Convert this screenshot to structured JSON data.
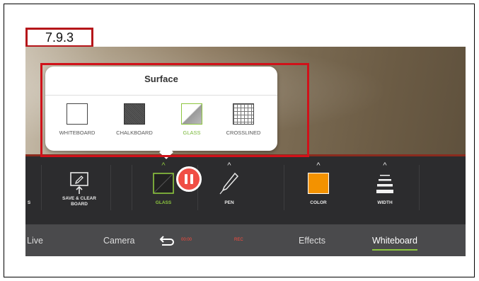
{
  "step_label": "7.9.3",
  "popup": {
    "title": "Surface",
    "options": [
      {
        "label": "WHITEBOARD",
        "icon": "whiteboard-swatch-icon",
        "selected": false
      },
      {
        "label": "CHALKBOARD",
        "icon": "chalkboard-swatch-icon",
        "selected": false
      },
      {
        "label": "GLASS",
        "icon": "glass-swatch-icon",
        "selected": true
      },
      {
        "label": "CROSSLINED",
        "icon": "crosslined-swatch-icon",
        "selected": false
      }
    ]
  },
  "toolbar": {
    "partial_label": "S",
    "save_clear": {
      "line1": "SAVE & CLEAR",
      "line2": "BOARD",
      "icon": "save-clear-board-icon"
    },
    "glass": {
      "label": "GLASS",
      "icon": "glass-surface-icon"
    },
    "pen": {
      "label": "PEN",
      "icon": "pen-icon"
    },
    "color": {
      "label": "COLOR",
      "icon": "color-swatch-icon",
      "value": "#f39200"
    },
    "width": {
      "label": "WIDTH",
      "icon": "line-width-icon"
    }
  },
  "tabs": {
    "live": "Live",
    "camera": "Camera",
    "timer": "00:00",
    "rec": "REC",
    "effects": "Effects",
    "whiteboard": "Whiteboard"
  },
  "colors": {
    "accent_green": "#8dc63f",
    "record_red": "#f04e45",
    "highlight_red": "#d0121a"
  }
}
